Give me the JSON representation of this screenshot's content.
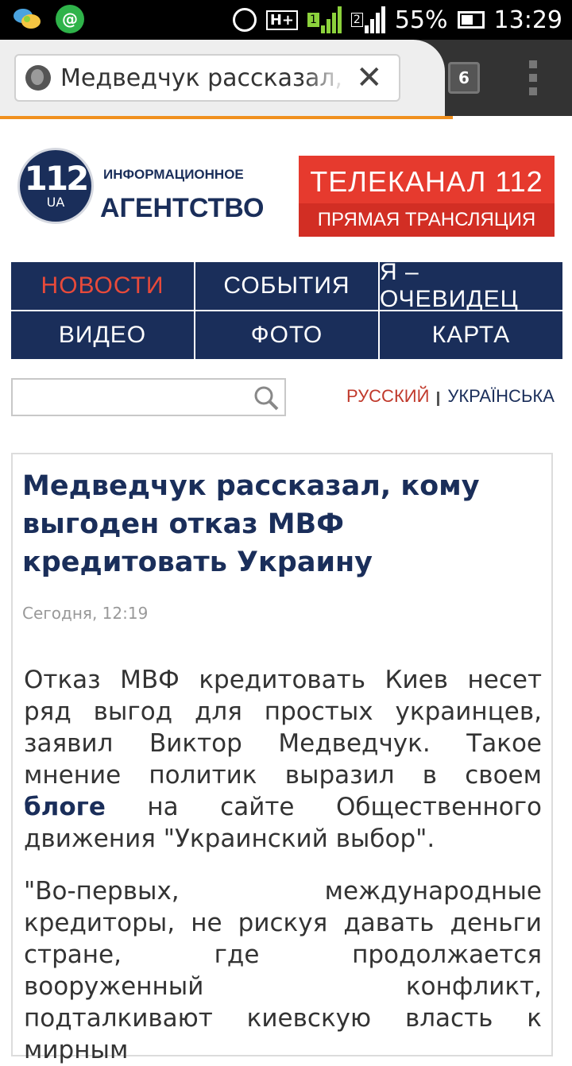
{
  "status_bar": {
    "battery": "55%",
    "time": "13:29",
    "network": "H+",
    "sim2": "2",
    "sim1": "1"
  },
  "browser": {
    "url_text": "Медведчук рассказал, кому",
    "tabs_count": "6"
  },
  "site": {
    "logo_number": "112",
    "logo_ua": "UA",
    "agency_small": "ИНФОРМАЦИОННОЕ",
    "agency_big": "АГЕНТСТВО",
    "tv_title": "ТЕЛЕКАНАЛ 112",
    "tv_sub": "ПРЯМАЯ ТРАНСЛЯЦИЯ"
  },
  "nav": {
    "items": [
      "НОВОСТИ",
      "СОБЫТИЯ",
      "Я – ОЧЕВИДЕЦ",
      "ВИДЕО",
      "ФОТО",
      "КАРТА"
    ]
  },
  "search": {
    "value": "",
    "placeholder": ""
  },
  "lang": {
    "ru": "РУССКИЙ",
    "ua": "УКРАЇНСЬКА"
  },
  "article": {
    "title": "Медведчук рассказал, кому выгоден отказ МВФ кредитовать Украину",
    "date": "Сегодня, 12:19",
    "p1_before": "Отказ МВФ кредитовать Киев несет ряд выгод для простых украинцев, заявил Виктор Медведчук. Такое мнение политик выразил в своем ",
    "p1_link": "блоге",
    "p1_after": " на сайте Общественного движения \"Украинский выбор\".",
    "p2": "\"Во-первых, международные кредиторы, не рискуя давать деньги стране, где продолжается вооруженный конфликт, подталкивают киевскую власть к мирным"
  },
  "colors": {
    "brand_navy": "#1a2e5a",
    "brand_red": "#e63a2e",
    "progress_orange": "#f0901e"
  }
}
